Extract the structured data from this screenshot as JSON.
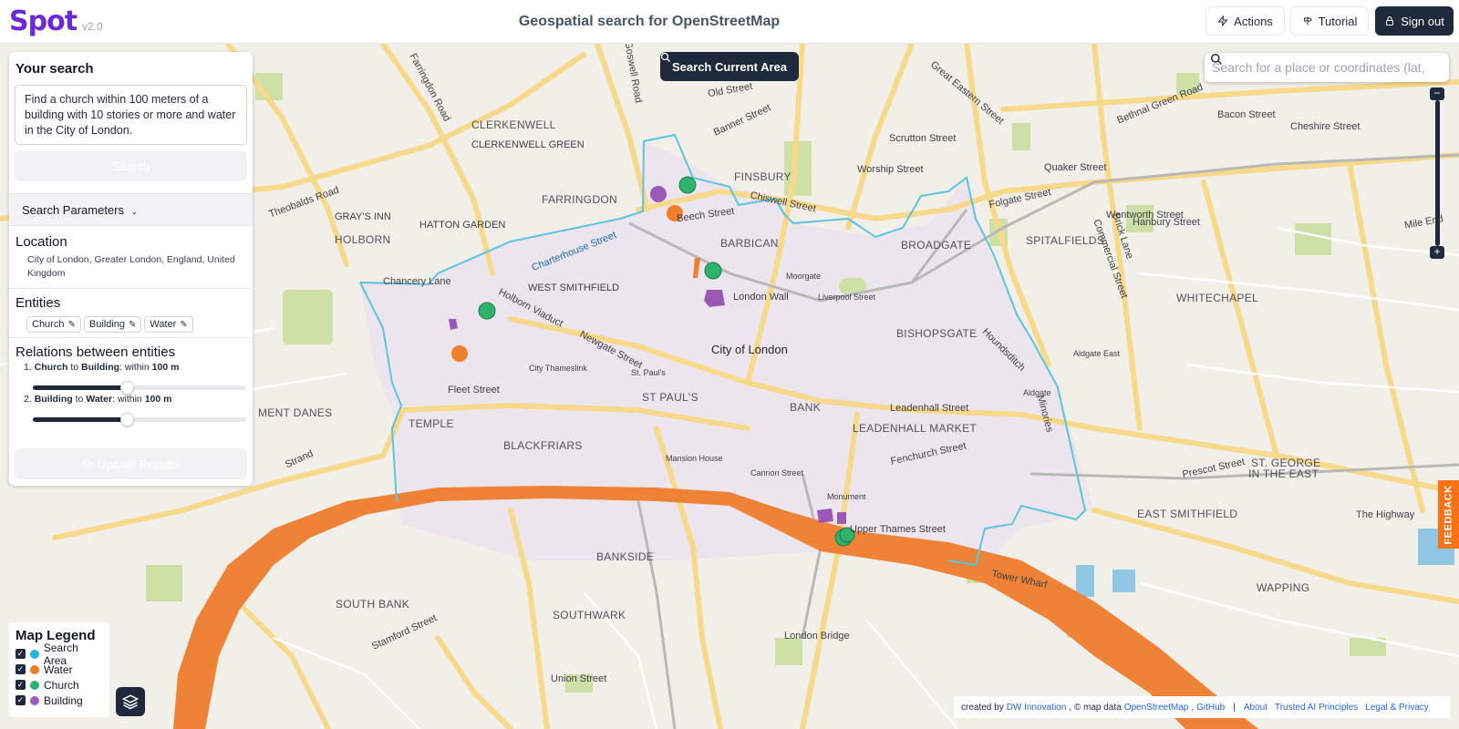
{
  "header": {
    "logo": "Spot",
    "version": "v2.0",
    "title": "Geospatial search for OpenStreetMap",
    "actions_label": "Actions",
    "tutorial_label": "Tutorial",
    "signout_label": "Sign out"
  },
  "map_controls": {
    "search_area_label": "Search Current Area",
    "place_search_placeholder": "Search for a place or coordinates (lat, lon)",
    "zoom_in": "+",
    "zoom_out": "−"
  },
  "panel": {
    "title": "Your search",
    "query": "Find a church within 100 meters of a building with 10 stories or more and water in the City of London.",
    "search_label": "Search",
    "params_label": "Search Parameters",
    "location_title": "Location",
    "location_value": "City of London, Greater London, England, United Kingdom",
    "entities_title": "Entities",
    "entities": [
      "Church",
      "Building",
      "Water"
    ],
    "relations_title": "Relations between entities",
    "relations": [
      {
        "num": "1.",
        "from": "Church",
        "to": "to",
        "target": "Building",
        "within": ": within",
        "distance": "100 m",
        "slider_fraction": 0.44
      },
      {
        "num": "2.",
        "from": "Building",
        "to": "to",
        "target": "Water",
        "within": ": within",
        "distance": "100 m",
        "slider_fraction": 0.44
      }
    ],
    "update_label": "Update Results"
  },
  "legend": {
    "title": "Map Legend",
    "items": [
      {
        "label": "Search Area",
        "color": "#22b8d8"
      },
      {
        "label": "Water",
        "color": "#f07f2a"
      },
      {
        "label": "Church",
        "color": "#2fb36a"
      },
      {
        "label": "Building",
        "color": "#9b59b6"
      }
    ]
  },
  "attribution": {
    "created_by": "created by",
    "dw": "DW Innovation",
    "map_data": ", © map data",
    "osm": "OpenStreetMap",
    "comma": ",",
    "github": "GitHub",
    "sep": "|",
    "about": "About",
    "ai": "Trusted AI Principles",
    "legal": "Legal & Privacy"
  },
  "feedback": "FEEDBACK",
  "map_labels": {
    "clerkenwell": "CLERKENWELL",
    "clerkenwell_green": "CLERKENWELL GREEN",
    "farringdon": "FARRINGDON",
    "grays_inn": "GRAY'S INN",
    "hatton_garden": "HATTON GARDEN",
    "holborn": "HOLBORN",
    "finsbury": "FINSBURY",
    "barbican": "BARBICAN",
    "broadgate": "BROADGATE",
    "spitalfields": "SPITALFIELDS",
    "whitechapel": "WHITECHAPEL",
    "west_smithfield": "WEST SMITHFIELD",
    "city_of_london": "City of London",
    "bishopsgate": "BISHOPSGATE",
    "st_pauls": "ST PAUL'S",
    "bank": "BANK",
    "leadenhall_market": "LEADENHALL MARKET",
    "temple": "TEMPLE",
    "blackfriars": "BLACKFRIARS",
    "inner_danes": "MENT DANES",
    "bankside": "BANKSIDE",
    "south_bank": "SOUTH BANK",
    "southwark": "SOUTHWARK",
    "wapping": "WAPPING",
    "east_smithfield": "EAST SMITHFIELD",
    "st_george": "ST. GEORGE",
    "in_the_east": "IN THE EAST",
    "beech_street": "Beech Street",
    "london_wall": "London Wall",
    "chiswell_street": "Chiswell Street",
    "worship_street": "Worship Street",
    "quaker_street": "Quaker Street",
    "folgate_street": "Folgate Street",
    "wentworth_street": "Wentworth Street",
    "newgate_street": "Newgate Street",
    "fleet_street": "Fleet Street",
    "holborn_viaduct": "Holborn Viaduct",
    "charterhouse_street": "Charterhouse Street",
    "leadenhall_street": "Leadenhall Street",
    "fenchurch_street": "Fenchurch Street",
    "upper_thames_street": "Upper Thames Street",
    "prescot_street": "Prescot Street",
    "the_highway": "The Highway",
    "tower_wharf": "Tower Wharf",
    "city_thameslink": "City Thameslink",
    "st_paul": "St. Paul's",
    "liverpool_street": "Liverpool Street",
    "moorgate": "Moorgate",
    "aldgate_east": "Aldgate East",
    "aldgate": "Aldgate",
    "monument": "Monument",
    "mansion_house": "Mansion House",
    "cannon_street": "Cannon Street",
    "farringdon_road": "Farringdon Road",
    "goswell_road": "Goswell Road",
    "old_street": "Old Street",
    "banner_street": "Banner Street",
    "great_eastern_street": "Great Eastern Street",
    "bethnal_green_road": "Bethnal Green Road",
    "bacon_street": "Bacon Street",
    "cheshire_street": "Cheshire Street",
    "scrutton_street": "Scrutton Street",
    "hanbury_street": "Hanbury Street",
    "mile_end": "Mile End",
    "theobalds_road": "Theobalds Road",
    "chancery_lane": "Chancery Lane",
    "strand": "Strand",
    "cannon_street_road": "Cannon Street",
    "london_bridge": "London Bridge",
    "union_street": "Union Street",
    "stamford_street": "Stamford Street",
    "houndsditch": "Houndsditch",
    "minories": "Minories",
    "commercial_street": "Commercial Street",
    "brick_lane": "Brick Lane"
  }
}
